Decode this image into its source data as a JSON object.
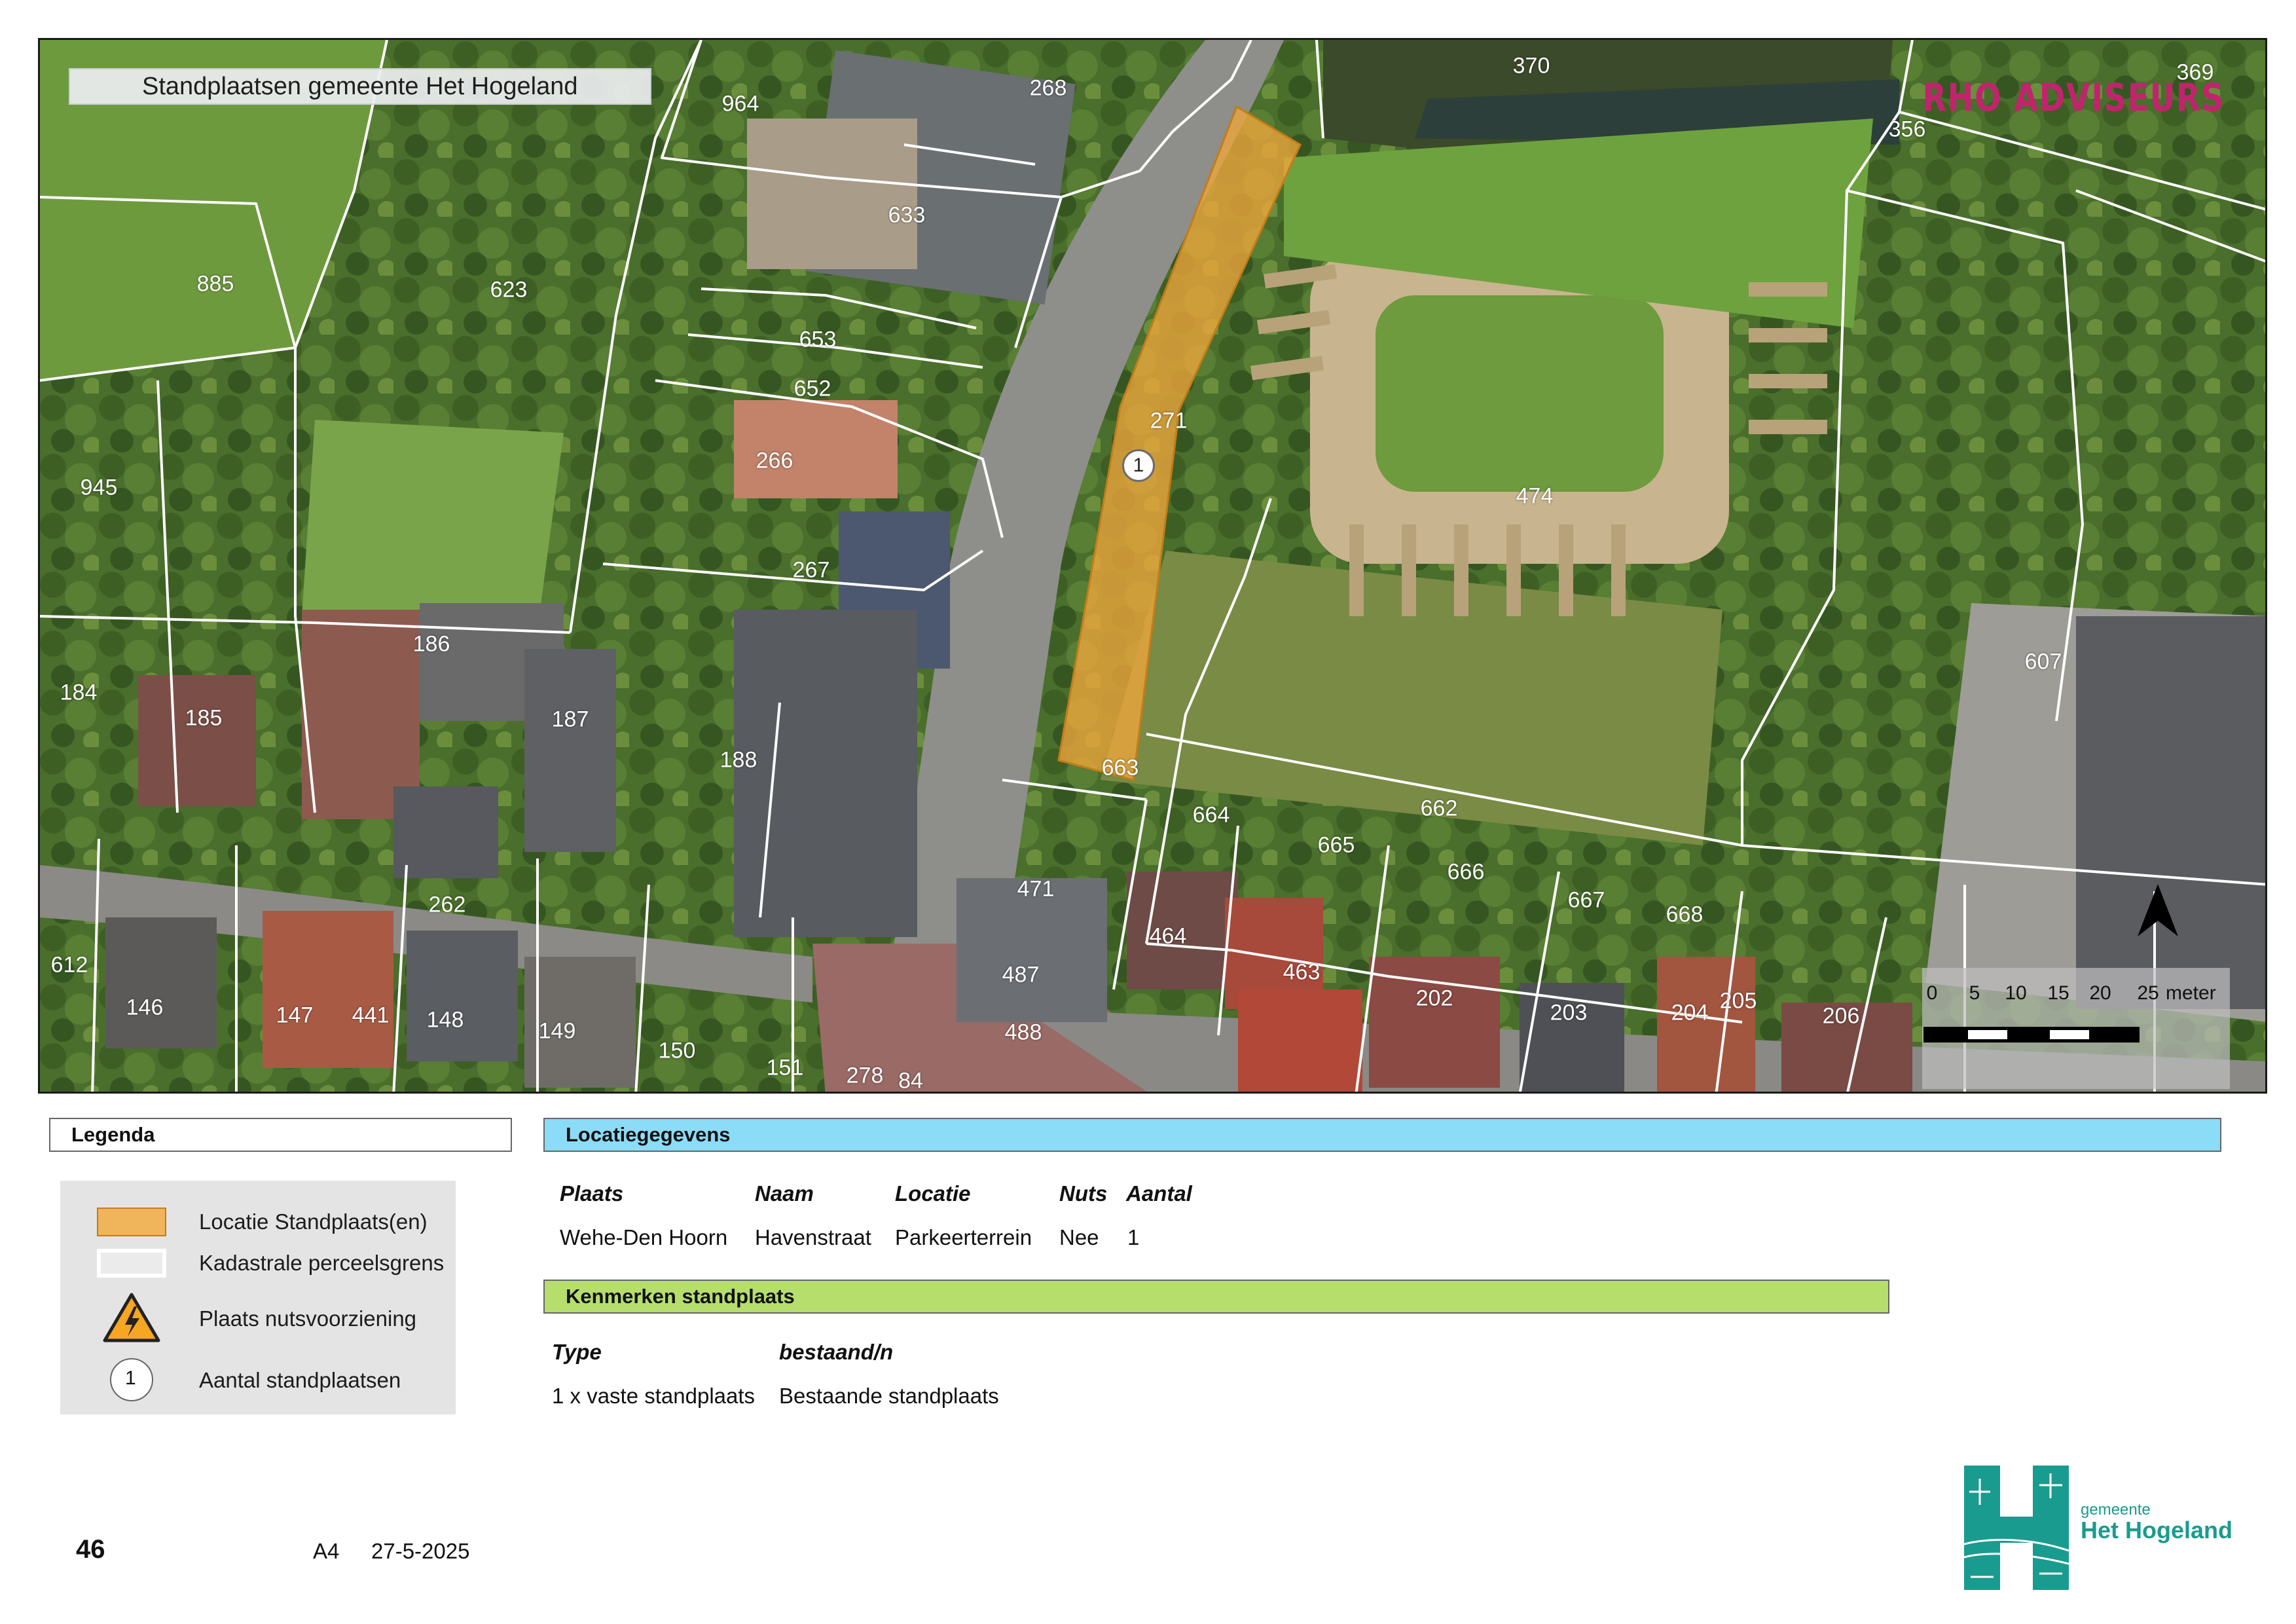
{
  "map": {
    "title": "Standplaatsen gemeente Het Hogeland",
    "brand": "RHO ADVISEURS",
    "location_marker_count": "1",
    "parcels": [
      {
        "label": "885"
      },
      {
        "label": "623"
      },
      {
        "label": "964"
      },
      {
        "label": "268"
      },
      {
        "label": "633"
      },
      {
        "label": "653"
      },
      {
        "label": "652"
      },
      {
        "label": "266"
      },
      {
        "label": "267"
      },
      {
        "label": "271"
      },
      {
        "label": "945"
      },
      {
        "label": "186"
      },
      {
        "label": "184"
      },
      {
        "label": "185"
      },
      {
        "label": "187"
      },
      {
        "label": "188"
      },
      {
        "label": "370"
      },
      {
        "label": "369"
      },
      {
        "label": "356"
      },
      {
        "label": "474"
      },
      {
        "label": "607"
      },
      {
        "label": "663"
      },
      {
        "label": "664"
      },
      {
        "label": "662"
      },
      {
        "label": "665"
      },
      {
        "label": "666"
      },
      {
        "label": "667"
      },
      {
        "label": "668"
      },
      {
        "label": "471"
      },
      {
        "label": "464"
      },
      {
        "label": "463"
      },
      {
        "label": "262"
      },
      {
        "label": "612"
      },
      {
        "label": "146"
      },
      {
        "label": "147"
      },
      {
        "label": "441"
      },
      {
        "label": "148"
      },
      {
        "label": "149"
      },
      {
        "label": "150"
      },
      {
        "label": "151"
      },
      {
        "label": "278"
      },
      {
        "label": "84"
      },
      {
        "label": "487"
      },
      {
        "label": "488"
      },
      {
        "label": "202"
      },
      {
        "label": "203"
      },
      {
        "label": "204"
      },
      {
        "label": "205"
      },
      {
        "label": "206"
      }
    ],
    "scale": {
      "ticks": [
        "0",
        "5",
        "10",
        "15",
        "20",
        "25"
      ],
      "unit": "meter"
    },
    "north_icon": "north-arrow-icon"
  },
  "legend": {
    "title": "Legenda",
    "items": [
      {
        "icon": "orange-area-swatch",
        "label": "Locatie Standplaats(en)",
        "color": "#f0b45a"
      },
      {
        "icon": "parcel-border-swatch",
        "label": "Kadastrale perceelsgrens",
        "color": "#ffffff"
      },
      {
        "icon": "warning-lightning-icon",
        "label": "Plaats nutsvoorziening",
        "color": "#f6a623"
      },
      {
        "icon": "count-circle-icon",
        "label": "Aantal standplaatsen",
        "value": "1"
      }
    ]
  },
  "location": {
    "title": "Locatiegegevens",
    "headers": [
      "Plaats",
      "Naam",
      "Locatie",
      "Nuts",
      "Aantal"
    ],
    "row": [
      "Wehe-Den Hoorn",
      "Havenstraat",
      "Parkeerterrein",
      "Nee",
      "1"
    ]
  },
  "characteristics": {
    "title": "Kenmerken standplaats",
    "headers": [
      "Type",
      "bestaand/n"
    ],
    "row": [
      "1 x vaste standplaats",
      "Bestaande standplaats"
    ]
  },
  "footer": {
    "page_number": "46",
    "paper": "A4",
    "date": "27-5-2025",
    "logo_small": "gemeente",
    "logo_big": "Het Hogeland"
  },
  "colors": {
    "location_fill": "#f0a73c",
    "location_header": "#8bdcf6",
    "characteristics_header": "#b6de6d",
    "brand": "#c2236e",
    "municipality": "#1a9b8f"
  }
}
